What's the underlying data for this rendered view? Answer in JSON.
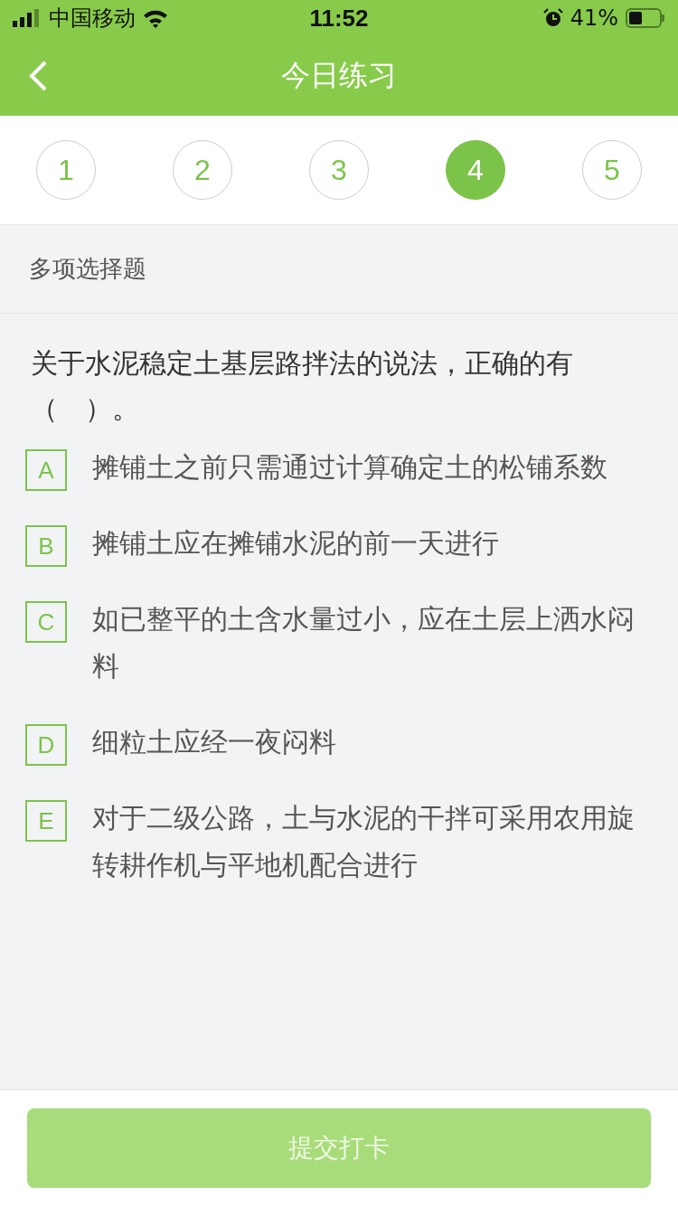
{
  "status_bar": {
    "carrier": "中国移动",
    "time": "11:52",
    "battery": "41%"
  },
  "nav": {
    "title": "今日练习"
  },
  "questions": [
    {
      "label": "1",
      "selected": false
    },
    {
      "label": "2",
      "selected": false
    },
    {
      "label": "3",
      "selected": false
    },
    {
      "label": "4",
      "selected": true
    },
    {
      "label": "5",
      "selected": false
    }
  ],
  "section": "多项选择题",
  "question": "关于水泥稳定土基层路拌法的说法，正确的有（　）。",
  "options": [
    {
      "letter": "A",
      "text": "摊铺土之前只需通过计算确定土的松铺系数",
      "selected": false
    },
    {
      "letter": "B",
      "text": "摊铺土应在摊铺水泥的前一天进行",
      "selected": false
    },
    {
      "letter": "C",
      "text": "如已整平的土含水量过小，应在土层上洒水闷料",
      "selected": false
    },
    {
      "letter": "D",
      "text": "细粒土应经一夜闷料",
      "selected": false
    },
    {
      "letter": "E",
      "text": "对于二级公路，土与水泥的干拌可采用农用旋转耕作机与平地机配合进行",
      "selected": false
    }
  ],
  "submit": {
    "label": "提交打卡",
    "disabled": true
  }
}
